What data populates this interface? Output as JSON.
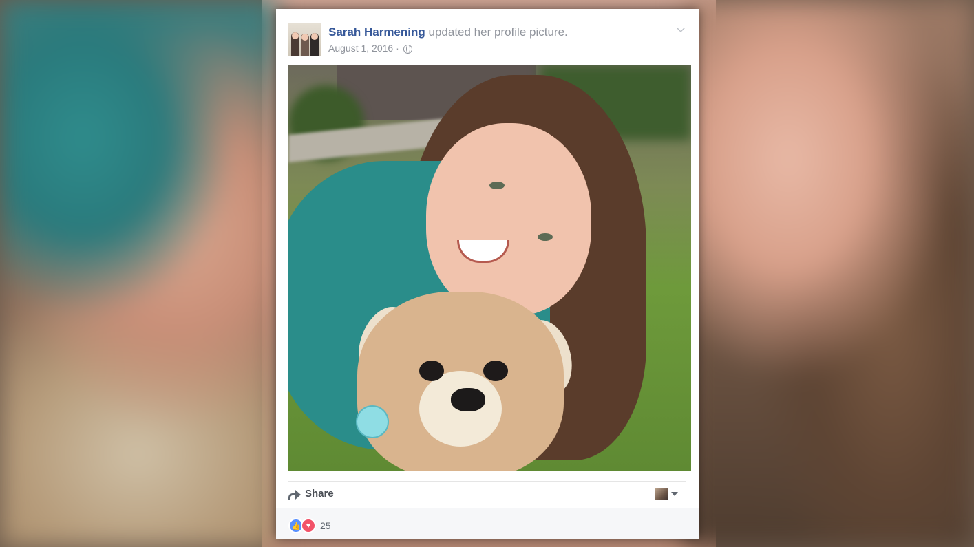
{
  "post": {
    "author": "Sarah Harmening",
    "action": "updated her profile picture.",
    "date": "August 1, 2016 ·",
    "privacy_icon": "globe-icon"
  },
  "actions": {
    "share_label": "Share"
  },
  "reactions": {
    "types": [
      "like-icon",
      "love-icon"
    ],
    "count": "25"
  },
  "colors": {
    "author": "#365899",
    "meta": "#90949c",
    "like": "#5890ff",
    "love": "#f25268"
  }
}
